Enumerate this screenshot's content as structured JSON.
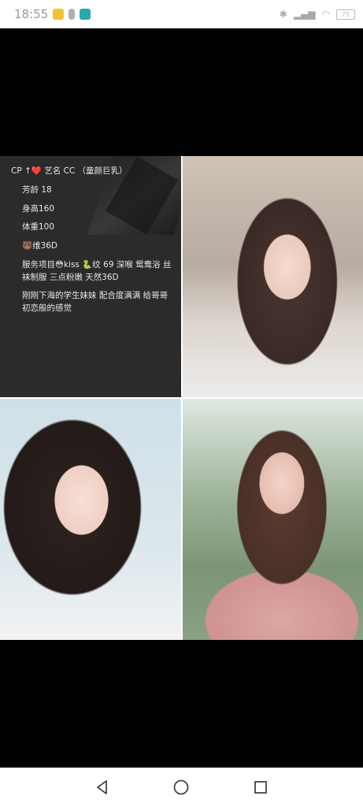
{
  "status_bar": {
    "time": "18:55",
    "battery": "75",
    "notification_icons": [
      "app-icon",
      "mic-icon",
      "app-icon"
    ],
    "system_icons": [
      "bluetooth-icon",
      "signal-icon",
      "signal-icon",
      "wifi-icon",
      "battery-icon"
    ]
  },
  "post": {
    "lines": [
      "CP ↑❤️  艺名 CC （童颜巨乳）",
      "芳龄 18",
      "身高160",
      "体重100",
      "🐻维36D",
      "服务项目😳kiss 🐍纹 69 深喉 鸳鸯浴 丝袜制服 三点粉嫩 天然36D",
      "刚刚下海的学生妹妹 配合度满满 给哥哥初恋般的感觉"
    ],
    "photos": [
      "photo-1",
      "photo-2",
      "photo-3"
    ]
  },
  "nav_bar": {
    "buttons": [
      "back-icon",
      "home-icon",
      "recents-icon"
    ]
  }
}
